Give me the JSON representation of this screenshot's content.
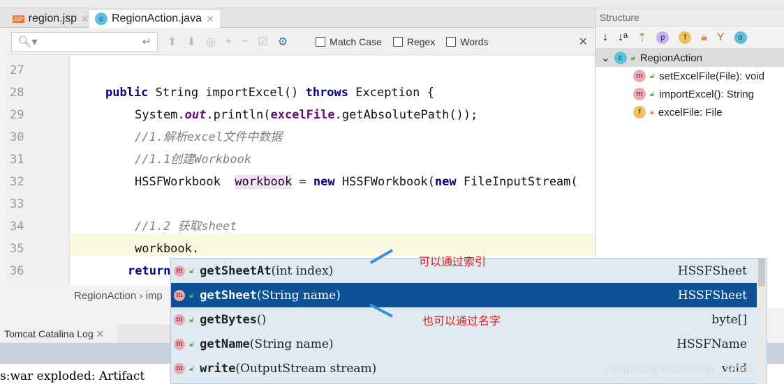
{
  "tabs": [
    {
      "label": "region.jsp",
      "icon": "jsp-file-icon"
    },
    {
      "label": "RegionAction.java",
      "icon": "class-icon",
      "active": true
    }
  ],
  "find": {
    "placeholder": "",
    "options": [
      "Match Case",
      "Regex",
      "Words"
    ]
  },
  "code": [
    {
      "n": "27",
      "t": ""
    },
    {
      "n": "28",
      "t": "public String importExcel() throws Exception {"
    },
    {
      "n": "29",
      "t": "System.out.println(excelFile.getAbsolutePath());"
    },
    {
      "n": "30",
      "t": "//1.解析excel文件中数据"
    },
    {
      "n": "31",
      "t": "//1.1创建Workbook"
    },
    {
      "n": "32",
      "t": "HSSFWorkbook  workbook = new HSSFWorkbook(new FileInputStream("
    },
    {
      "n": "33",
      "t": ""
    },
    {
      "n": "34",
      "t": "//1.2 获取sheet"
    },
    {
      "n": "35",
      "t": "workbook."
    },
    {
      "n": "36",
      "t": "return"
    }
  ],
  "breadcrumb": [
    "RegionAction",
    "imp"
  ],
  "structure": {
    "title": "Structure",
    "root": "RegionAction",
    "items": [
      {
        "kind": "m",
        "label": "setExcelFile(File): void",
        "access": "public"
      },
      {
        "kind": "m",
        "label": "importExcel(): String",
        "access": "public"
      },
      {
        "kind": "f",
        "label": "excelFile: File",
        "access": "private"
      }
    ]
  },
  "bottom": {
    "tab": "Tomcat Catalina Log",
    "console": "s:war exploded: Artifact"
  },
  "completion": [
    {
      "name": "getSheetAt",
      "params": "(int index)",
      "type": "HSSFSheet"
    },
    {
      "name": "getSheet",
      "params": "(String name)",
      "type": "HSSFSheet",
      "selected": true
    },
    {
      "name": "getBytes",
      "params": "()",
      "type": "byte[]"
    },
    {
      "name": "getName",
      "params": "(String name)",
      "type": "HSSFName"
    },
    {
      "name": "write",
      "params": "(OutputStream stream)",
      "type": "void"
    }
  ],
  "annotations": [
    "可以通过索引",
    "也可以通过名字"
  ],
  "watermark": "https://blog.csdn.net/qq_  53340",
  "colors": {
    "selection": "#0d5296",
    "annotation": "#e0201a",
    "arrow": "#3a8fe0"
  }
}
